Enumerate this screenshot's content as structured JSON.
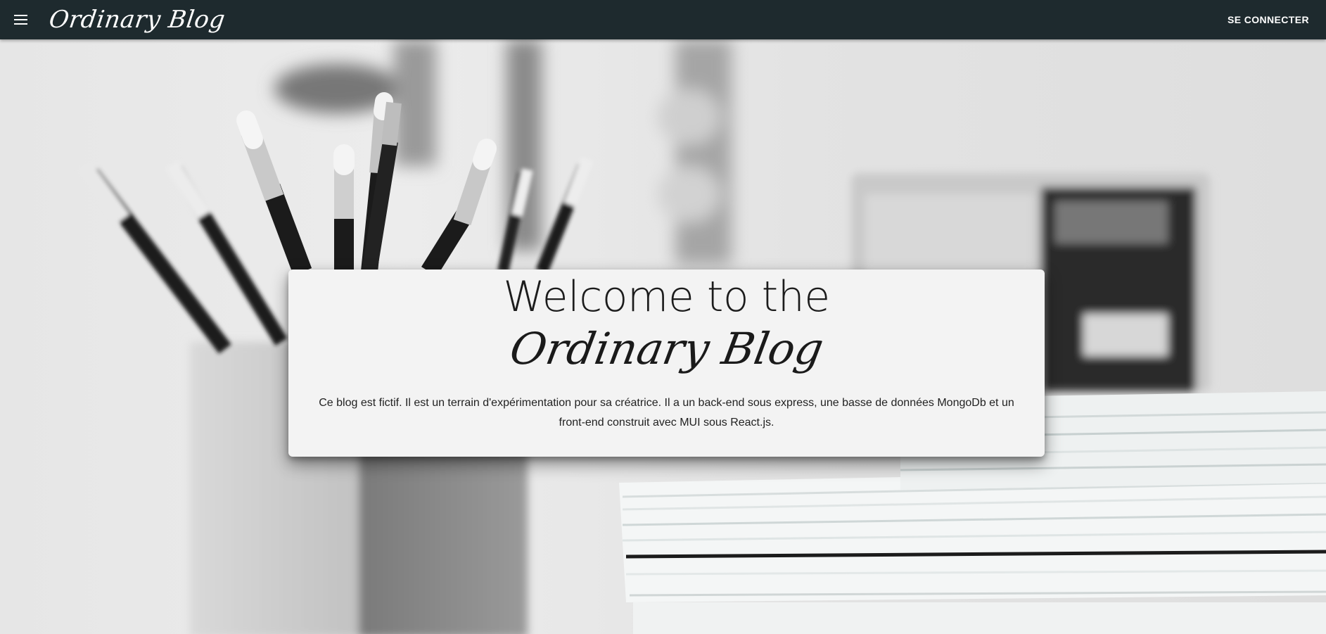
{
  "appbar": {
    "brand": "Ordinary Blog",
    "login_label": "SE CONNECTER",
    "menu_icon": "menu-icon",
    "background_color": "#1e2a2e"
  },
  "hero": {
    "title_line1": "Welcome to the",
    "title_line2": "Ordinary Blog",
    "description": "Ce blog est fictif. Il est un terrain d'expérimentation pour sa créatrice. Il a un back-end sous express, une basse de données MongoDb et un front-end construit avec MUI sous React.js."
  }
}
